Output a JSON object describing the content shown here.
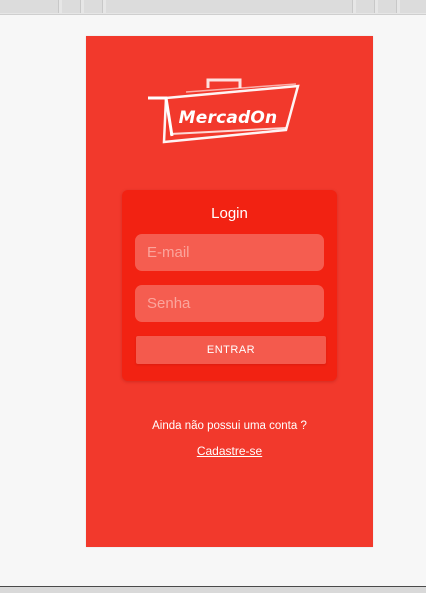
{
  "brand": {
    "name": "MercadOn"
  },
  "login": {
    "title": "Login",
    "email_placeholder": "E-mail",
    "password_placeholder": "Senha",
    "submit_label": "ENTRAR"
  },
  "signup": {
    "question": "Ainda não possui uma conta ?",
    "link_label": "Cadastre-se"
  },
  "colors": {
    "background": "#f2392c",
    "card": "#f22212",
    "field": "#f55d50",
    "button": "#f45a4d",
    "text": "#ffffff"
  }
}
